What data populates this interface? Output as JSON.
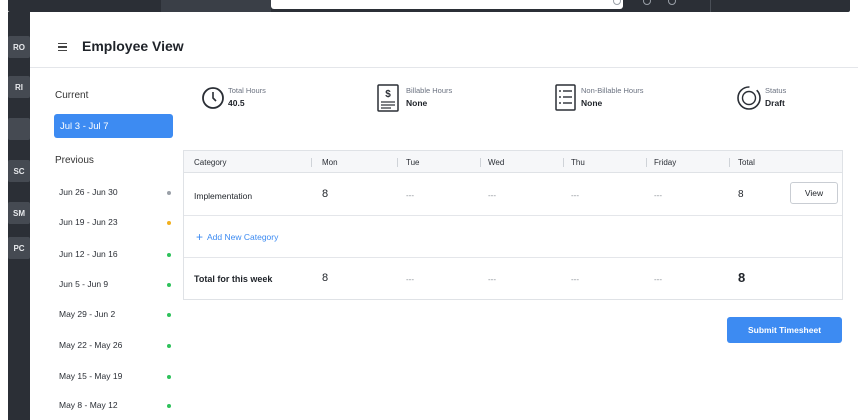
{
  "rail": {
    "items": [
      "RO",
      "RI",
      "",
      "SC",
      "SM",
      "PC"
    ]
  },
  "header": {
    "title": "Employee View"
  },
  "periods": {
    "current_label": "Current",
    "current_range": "Jul 3 - Jul 7",
    "previous_label": "Previous",
    "items": [
      {
        "label": "Jun 26 - Jun 30",
        "status_color": "#9aa0a8"
      },
      {
        "label": "Jun 19 - Jun 23",
        "status_color": "#f2b01e"
      },
      {
        "label": "Jun 12 - Jun 16",
        "status_color": "#2ec25b"
      },
      {
        "label": "Jun 5 - Jun 9",
        "status_color": "#2ec25b"
      },
      {
        "label": "May 29 - Jun 2",
        "status_color": "#2ec25b"
      },
      {
        "label": "May 22 - May 26",
        "status_color": "#2ec25b"
      },
      {
        "label": "May 15 - May 19",
        "status_color": "#2ec25b"
      },
      {
        "label": "May 8 - May 12",
        "status_color": "#2ec25b"
      }
    ]
  },
  "stats": {
    "total_hours": {
      "label": "Total Hours",
      "value": "40.5",
      "icon": "clock-icon"
    },
    "billable": {
      "label": "Billable Hours",
      "value": "None",
      "icon": "billable-document-icon"
    },
    "non_billable": {
      "label": "Non-Billable Hours",
      "value": "None",
      "icon": "list-document-icon"
    },
    "status": {
      "label": "Status",
      "value": "Draft",
      "icon": "status-ring-icon"
    }
  },
  "table": {
    "columns": [
      "Category",
      "Mon",
      "Tue",
      "Wed",
      "Thu",
      "Friday",
      "Total"
    ],
    "rows": [
      {
        "category": "Implementation",
        "mon": "8",
        "tue": "---",
        "wed": "---",
        "thu": "---",
        "fri": "---",
        "total": "8",
        "action": "View"
      }
    ],
    "add_category": "Add New Category",
    "totals": {
      "label": "Total for this week",
      "mon": "8",
      "tue": "---",
      "wed": "---",
      "thu": "---",
      "fri": "---",
      "total": "8"
    }
  },
  "actions": {
    "submit": "Submit Timesheet"
  },
  "colors": {
    "accent": "#3d8bf2",
    "rail": "#2b2f36"
  }
}
